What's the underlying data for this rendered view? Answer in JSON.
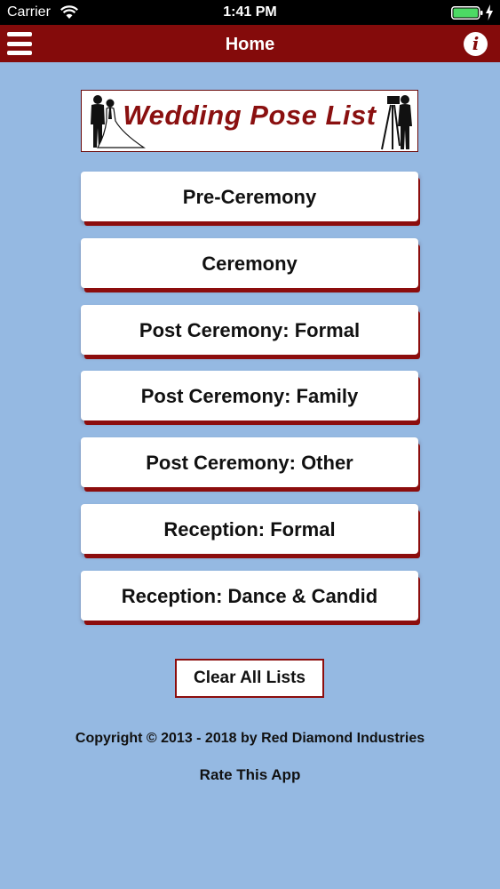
{
  "status_bar": {
    "carrier": "Carrier",
    "time": "1:41 PM",
    "battery_color": "#4cd964"
  },
  "nav_bar": {
    "title": "Home",
    "background": "#840b0b",
    "left_icon": "hamburger-menu-icon",
    "right_icon": "info-icon",
    "info_glyph": "i"
  },
  "logo": {
    "text": "Wedding Pose List"
  },
  "menu": {
    "items": [
      {
        "label": "Pre-Ceremony"
      },
      {
        "label": "Ceremony"
      },
      {
        "label": "Post Ceremony: Formal"
      },
      {
        "label": "Post Ceremony: Family"
      },
      {
        "label": "Post Ceremony: Other"
      },
      {
        "label": "Reception: Formal"
      },
      {
        "label": "Reception: Dance & Candid"
      }
    ]
  },
  "footer": {
    "clear_label": "Clear All Lists",
    "copyright": "Copyright © 2013 - 2018 by Red Diamond Industries",
    "rate_label": "Rate This App"
  },
  "colors": {
    "background": "#95b9e2",
    "accent": "#8c0d0d"
  }
}
